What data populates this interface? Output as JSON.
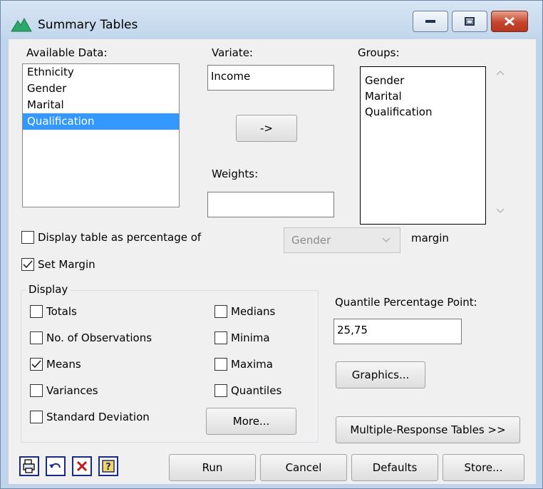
{
  "window": {
    "title": "Summary Tables"
  },
  "available_data": {
    "label": "Available Data:",
    "items": [
      "Ethnicity",
      "Gender",
      "Marital",
      "Qualification"
    ],
    "selected": "Qualification"
  },
  "variate": {
    "label": "Variate:",
    "value": "Income"
  },
  "move_button": {
    "label": "->"
  },
  "weights": {
    "label": "Weights:",
    "value": ""
  },
  "groups": {
    "label": "Groups:",
    "items": [
      "Gender",
      "Marital",
      "Qualification"
    ]
  },
  "percentage": {
    "label": "Display table as percentage of",
    "checked": false,
    "select_value": "Gender",
    "suffix": "margin"
  },
  "set_margin": {
    "label": "Set Margin",
    "checked": true
  },
  "display": {
    "legend": "Display",
    "totals": {
      "label": "Totals",
      "checked": false
    },
    "observations": {
      "label": "No. of Observations",
      "checked": false
    },
    "means": {
      "label": "Means",
      "checked": true
    },
    "variances": {
      "label": "Variances",
      "checked": false
    },
    "std_dev": {
      "label": "Standard Deviation",
      "checked": false
    },
    "medians": {
      "label": "Medians",
      "checked": false
    },
    "minima": {
      "label": "Minima",
      "checked": false
    },
    "maxima": {
      "label": "Maxima",
      "checked": false
    },
    "quantiles": {
      "label": "Quantiles",
      "checked": false
    },
    "more_label": "More..."
  },
  "quantile": {
    "label": "Quantile Percentage Point:",
    "value": "25,75"
  },
  "graphics_label": "Graphics...",
  "multi_response_label": "Multiple-Response Tables >>",
  "footer": {
    "run": "Run",
    "cancel": "Cancel",
    "defaults": "Defaults",
    "store": "Store..."
  },
  "colors": {
    "selection": "#3399ff",
    "close_button": "#c6452c",
    "title_bar": "#c2d6ec"
  }
}
